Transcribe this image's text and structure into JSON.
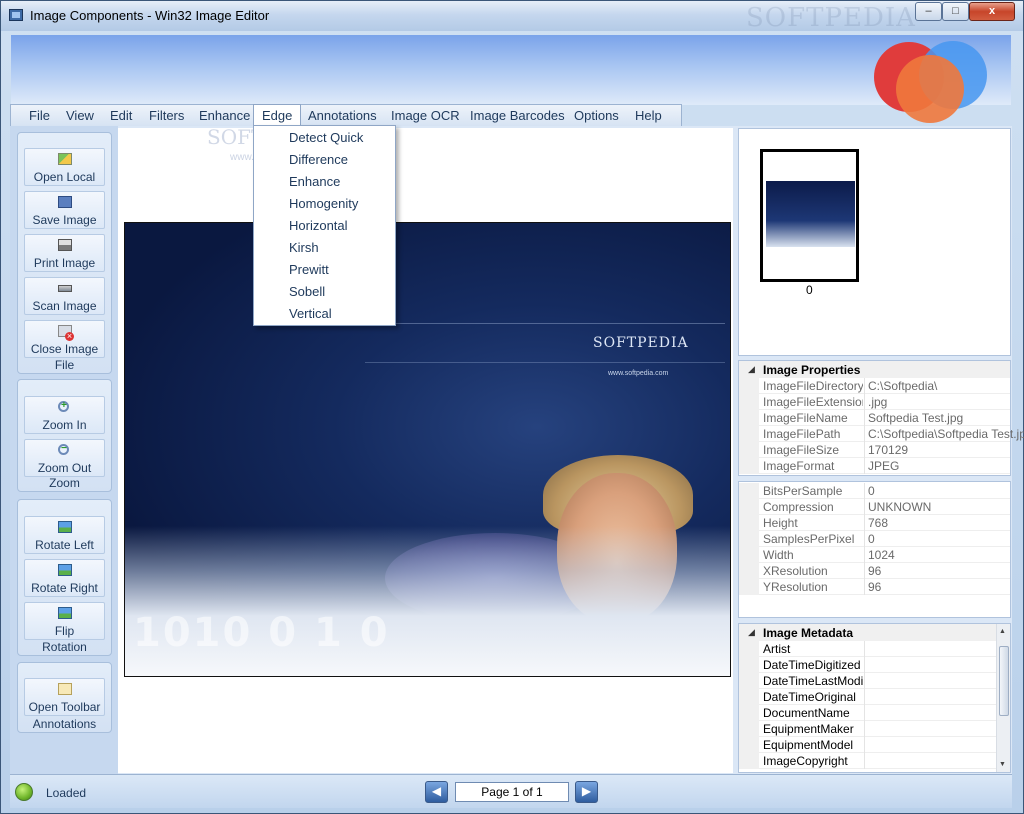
{
  "window": {
    "title": "Image Components - Win32 Image Editor",
    "watermark": "SOFTPEDIA",
    "controls": {
      "minimize": "–",
      "maximize": "□",
      "close": "x"
    }
  },
  "menu": {
    "items": [
      {
        "label": "File"
      },
      {
        "label": "View"
      },
      {
        "label": "Edit"
      },
      {
        "label": "Filters"
      },
      {
        "label": "Enhance"
      },
      {
        "label": "Edge"
      },
      {
        "label": "Annotations"
      },
      {
        "label": "Image OCR"
      },
      {
        "label": "Image Barcodes"
      },
      {
        "label": "Options"
      },
      {
        "label": "Help"
      }
    ],
    "active": "Edge"
  },
  "edge_menu": {
    "items": [
      "Detect Quick",
      "Difference",
      "Enhance",
      "Homogenity",
      "Horizontal",
      "Kirsh",
      "Prewitt",
      "Sobell",
      "Vertical"
    ],
    "watermark": "SOFTPEDIA",
    "watermark_url": "www.softpedia.com"
  },
  "ribbon": {
    "file": {
      "label": "File",
      "buttons": [
        "Open Local",
        "Save Image",
        "Print Image",
        "Scan Image",
        "Close Image"
      ]
    },
    "zoom": {
      "label": "Zoom",
      "buttons": [
        "Zoom In",
        "Zoom Out"
      ]
    },
    "rotation": {
      "label": "Rotation",
      "buttons": [
        "Rotate Left",
        "Rotate Right",
        "Flip"
      ]
    },
    "annotations": {
      "label": "Annotations",
      "buttons": [
        "Open Toolbar"
      ]
    }
  },
  "image": {
    "brand": "SOFTPEDIA",
    "url": "www.softpedia.com",
    "digits": "1010 0 1 0"
  },
  "thumbnail": {
    "label": "0"
  },
  "image_properties": {
    "header": "Image Properties",
    "rows": [
      {
        "key": "ImageFileDirectory",
        "value": "C:\\Softpedia\\"
      },
      {
        "key": "ImageFileExtension",
        "value": ".jpg"
      },
      {
        "key": "ImageFileName",
        "value": "Softpedia Test.jpg"
      },
      {
        "key": "ImageFilePath",
        "value": "C:\\Softpedia\\Softpedia Test.jp"
      },
      {
        "key": "ImageFileSize",
        "value": "170129"
      },
      {
        "key": "ImageFormat",
        "value": "JPEG"
      }
    ]
  },
  "image_details": {
    "rows": [
      {
        "key": "BitsPerSample",
        "value": "0"
      },
      {
        "key": "Compression",
        "value": "UNKNOWN"
      },
      {
        "key": "Height",
        "value": "768"
      },
      {
        "key": "SamplesPerPixel",
        "value": "0"
      },
      {
        "key": "Width",
        "value": "1024"
      },
      {
        "key": "XResolution",
        "value": "96"
      },
      {
        "key": "YResolution",
        "value": "96"
      }
    ]
  },
  "image_metadata": {
    "header": "Image Metadata",
    "rows": [
      {
        "key": "Artist",
        "value": ""
      },
      {
        "key": "DateTimeDigitized",
        "value": ""
      },
      {
        "key": "DateTimeLastModifie",
        "value": ""
      },
      {
        "key": "DateTimeOriginal",
        "value": ""
      },
      {
        "key": "DocumentName",
        "value": ""
      },
      {
        "key": "EquipmentMaker",
        "value": ""
      },
      {
        "key": "EquipmentModel",
        "value": ""
      },
      {
        "key": "ImageCopyright",
        "value": ""
      }
    ]
  },
  "status": {
    "text": "Loaded",
    "page": "Page 1 of 1",
    "prev_icon": "arrow-left-icon",
    "next_icon": "arrow-right-icon"
  },
  "colors": {
    "accent": "#1e395b",
    "banner": "#7aa3ea",
    "status_ok": "#6fb52a"
  }
}
